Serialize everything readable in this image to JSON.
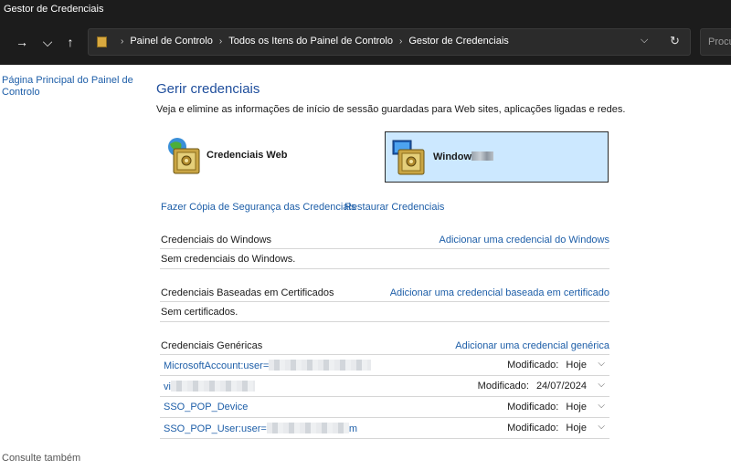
{
  "window": {
    "title": "Gestor de Credenciais"
  },
  "nav": {
    "forward_icon": "→",
    "up_icon": "↑",
    "dropdown_icon": "⌵",
    "refresh_icon": "↻",
    "breadcrumb_sep": "›",
    "breadcrumbs": [
      "Painel de Controlo",
      "Todos os Itens do Painel de Controlo",
      "Gestor de Credenciais"
    ],
    "search_placeholder": "Procu"
  },
  "sidebar": {
    "home_link": "Página Principal do Painel de Controlo",
    "see_also": "Consulte também"
  },
  "main": {
    "title": "Gerir credenciais",
    "description": "Veja e elimine as informações de início de sessão guardadas para Web sites, aplicações ligadas e redes.",
    "vaults": {
      "web": "Credenciais Web",
      "windows": "Window"
    },
    "backup_link": "Fazer Cópia de Segurança das Credenciais",
    "restore_link": "Restaurar Credenciais",
    "windows_section": {
      "title": "Credenciais do Windows",
      "add_link": "Adicionar uma credencial do Windows",
      "empty": "Sem credenciais do Windows."
    },
    "cert_section": {
      "title": "Credenciais Baseadas em Certificados",
      "add_link": "Adicionar uma credencial baseada em certificado",
      "empty": "Sem certificados."
    },
    "generic_section": {
      "title": "Credenciais Genéricas",
      "add_link": "Adicionar uma credencial genérica",
      "items": [
        {
          "name": "MicrosoftAccount:user=",
          "suffix": "",
          "modified_label": "Modificado:",
          "modified": "Hoje"
        },
        {
          "name": "vi",
          "suffix": "",
          "modified_label": "Modificado:",
          "modified": "24/07/2024"
        },
        {
          "name": "SSO_POP_Device",
          "suffix": "",
          "modified_label": "Modificado:",
          "modified": "Hoje"
        },
        {
          "name": "SSO_POP_User:user=",
          "suffix": "m",
          "modified_label": "Modificado:",
          "modified": "Hoje"
        }
      ],
      "chevron_icon": "⌵"
    }
  },
  "colors": {
    "link": "#1d5ea8",
    "title": "#1f4e9c",
    "chrome": "#1c1c1c",
    "selected_vault": "#cce8ff"
  }
}
